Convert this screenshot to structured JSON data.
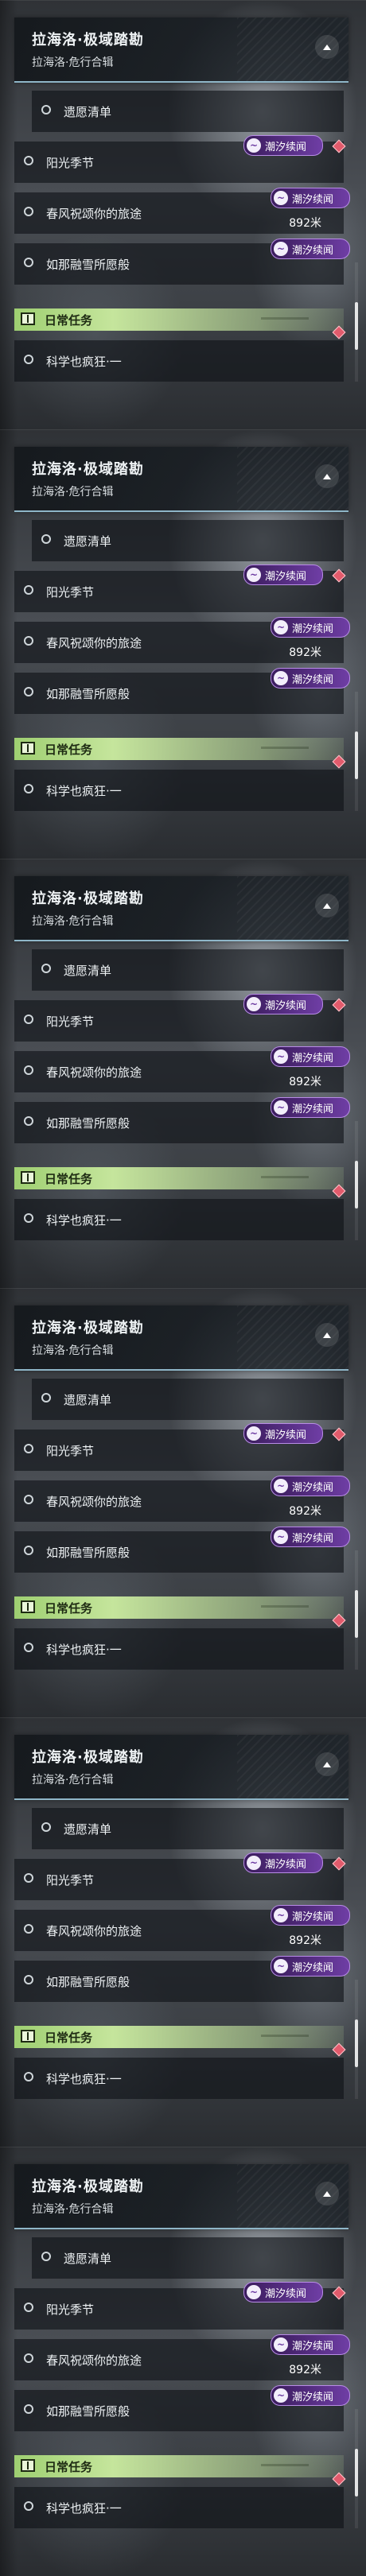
{
  "quest": {
    "title": "拉海洛·极域踏勘",
    "subtitle": "拉海洛·危行合辑",
    "items": [
      {
        "label": "遗愿清单"
      },
      {
        "label": "阳光季节"
      },
      {
        "label": "春风祝颂你的旅途",
        "distance": "892米"
      },
      {
        "label": "如那融雪所愿般"
      }
    ],
    "tag_label": "潮汐续闻",
    "tag_icon": "tide-icon"
  },
  "daily": {
    "title": "日常任务",
    "items": [
      {
        "label": "科学也疯狂·一"
      }
    ]
  },
  "colors": {
    "accent_line": "#8fb6c8",
    "daily_bar": "#9ecf71",
    "tag": "#6f3ea5",
    "marker": "#e25b6c"
  },
  "frames": [
    1,
    2,
    3,
    4,
    5,
    6
  ]
}
